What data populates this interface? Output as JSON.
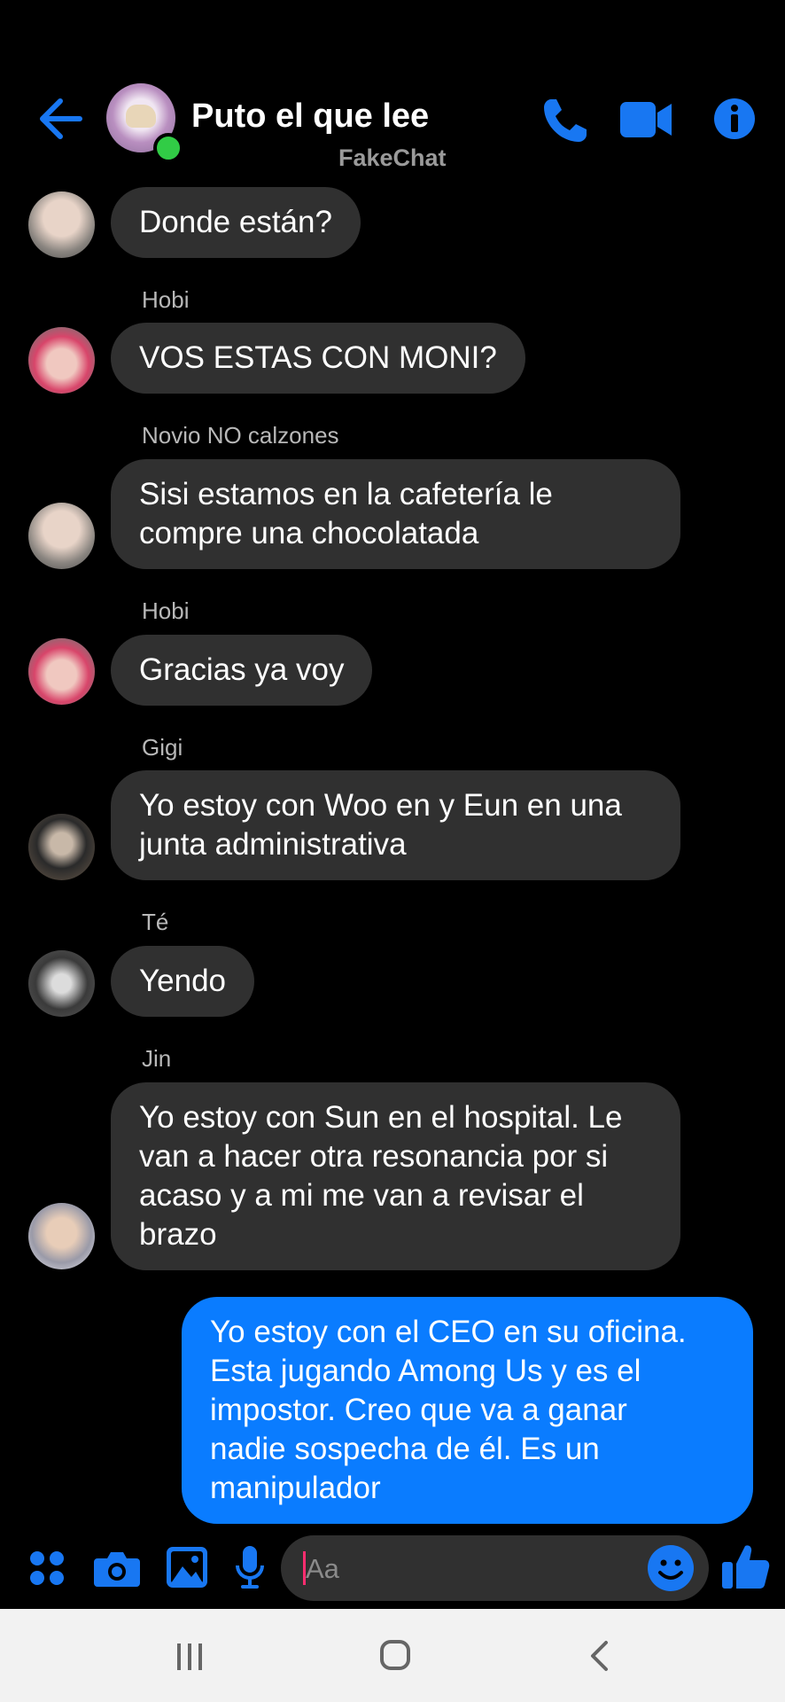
{
  "header": {
    "title": "Puto el que lee",
    "watermark": "FakeChat",
    "icons": [
      "back-arrow-icon",
      "phone-icon",
      "video-camera-icon",
      "info-icon"
    ]
  },
  "messages": [
    {
      "sender": "",
      "lines": [
        "Donde están?"
      ]
    },
    {
      "sender": "Hobi",
      "lines": [
        "VOS ESTAS CON MONI?"
      ]
    },
    {
      "sender": "Novio NO calzones",
      "lines": [
        "Sisi estamos en la cafetería le",
        "compre una chocolatada"
      ]
    },
    {
      "sender": "Hobi",
      "lines": [
        "Gracias ya voy"
      ]
    },
    {
      "sender": "Gigi",
      "lines": [
        "Yo estoy con Woo en y Eun en una",
        "junta administrativa"
      ]
    },
    {
      "sender": "Té",
      "lines": [
        "Yendo"
      ]
    },
    {
      "sender": "Jin",
      "lines": [
        "Yo estoy con Sun en el hospital. Le",
        "van a hacer otra resonancia por si",
        "acaso y a mi me van a revisar el",
        "brazo"
      ]
    },
    {
      "sender": "",
      "lines": [
        "Yo estoy con el CEO en su oficina.",
        "Esta jugando Among Us y es el",
        "impostor. Creo que va a ganar",
        "nadie sospecha de él. Es un",
        "manipulador"
      ]
    }
  ],
  "composer": {
    "placeholder": "Aa",
    "icons": [
      "apps-grid-icon",
      "camera-icon",
      "gallery-icon",
      "microphone-icon",
      "emoji-icon",
      "thumbs-up-icon"
    ]
  },
  "colors": {
    "accent": "#0a7cff",
    "bubble_other": "#303030",
    "background": "#000000",
    "online": "#31cc46"
  }
}
